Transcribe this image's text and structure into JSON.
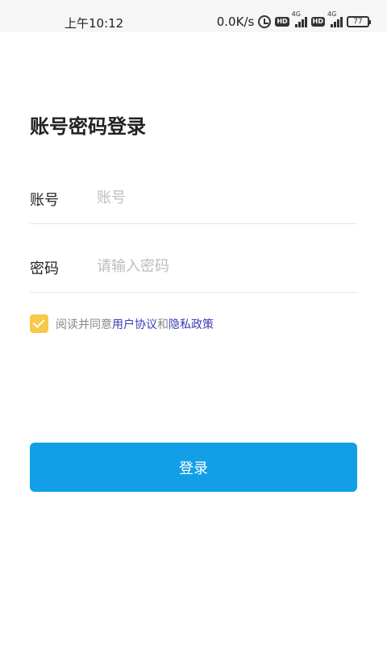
{
  "status_bar": {
    "time": "上午10:12",
    "network_speed": "0.0K/s",
    "hd_label": "HD",
    "network_type": "4G",
    "battery_level": "77"
  },
  "page": {
    "title": "账号密码登录"
  },
  "form": {
    "account": {
      "label": "账号",
      "placeholder": "账号",
      "value": ""
    },
    "password": {
      "label": "密码",
      "placeholder": "请输入密码",
      "value": ""
    }
  },
  "agreement": {
    "checked": true,
    "prefix": "阅读并同意",
    "user_agreement": "用户协议",
    "conjunction": "和",
    "privacy_policy": "隐私政策",
    "checkbox_color": "#f7c948",
    "link_color": "#3b3bb8"
  },
  "login_button": {
    "label": "登录",
    "color": "#139fe8"
  }
}
